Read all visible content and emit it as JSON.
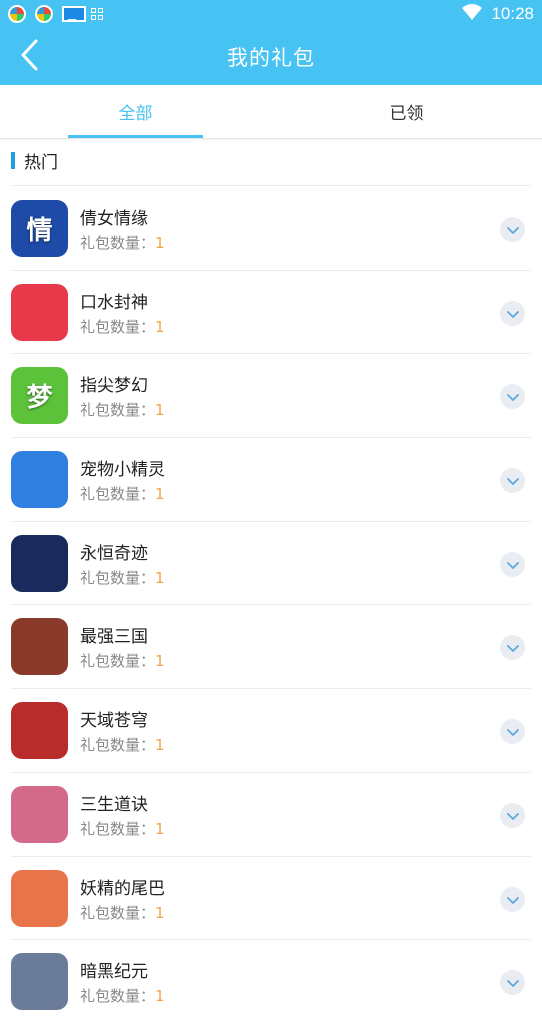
{
  "statusbar": {
    "time": "10:28",
    "icons": [
      "app-icon",
      "app-icon",
      "monitor-icon",
      "grid-icon",
      "wifi-icon"
    ]
  },
  "header": {
    "title": "我的礼包",
    "back_icon": "chevron-left-icon"
  },
  "tabs": [
    {
      "label": "全部",
      "active": true
    },
    {
      "label": "已领",
      "active": false
    }
  ],
  "section": {
    "title": "热门"
  },
  "items": [
    {
      "name": "倩女情缘",
      "count_label": "礼包数量：",
      "count": "1",
      "icon_glyph": "情",
      "icon_bg": "#1e4aa8"
    },
    {
      "name": "口水封神",
      "count_label": "礼包数量：",
      "count": "1",
      "icon_glyph": "",
      "icon_bg": "#e8394a"
    },
    {
      "name": "指尖梦幻",
      "count_label": "礼包数量：",
      "count": "1",
      "icon_glyph": "梦",
      "icon_bg": "#5cc23a"
    },
    {
      "name": "宠物小精灵",
      "count_label": "礼包数量：",
      "count": "1",
      "icon_glyph": "",
      "icon_bg": "#2f7fe0"
    },
    {
      "name": "永恒奇迹",
      "count_label": "礼包数量：",
      "count": "1",
      "icon_glyph": "",
      "icon_bg": "#1b2a5c"
    },
    {
      "name": "最强三国",
      "count_label": "礼包数量：",
      "count": "1",
      "icon_glyph": "",
      "icon_bg": "#8a3a2a"
    },
    {
      "name": "天域苍穹",
      "count_label": "礼包数量：",
      "count": "1",
      "icon_glyph": "",
      "icon_bg": "#b82c2c"
    },
    {
      "name": "三生道诀",
      "count_label": "礼包数量：",
      "count": "1",
      "icon_glyph": "",
      "icon_bg": "#d46a8a"
    },
    {
      "name": "妖精的尾巴",
      "count_label": "礼包数量：",
      "count": "1",
      "icon_glyph": "",
      "icon_bg": "#e8744a"
    },
    {
      "name": "暗黑纪元",
      "count_label": "礼包数量：",
      "count": "1",
      "icon_glyph": "",
      "icon_bg": "#6a7c9a"
    }
  ],
  "colors": {
    "accent": "#46c3f2",
    "count": "#f5a34a",
    "section_bar": "#1e9fe0"
  }
}
